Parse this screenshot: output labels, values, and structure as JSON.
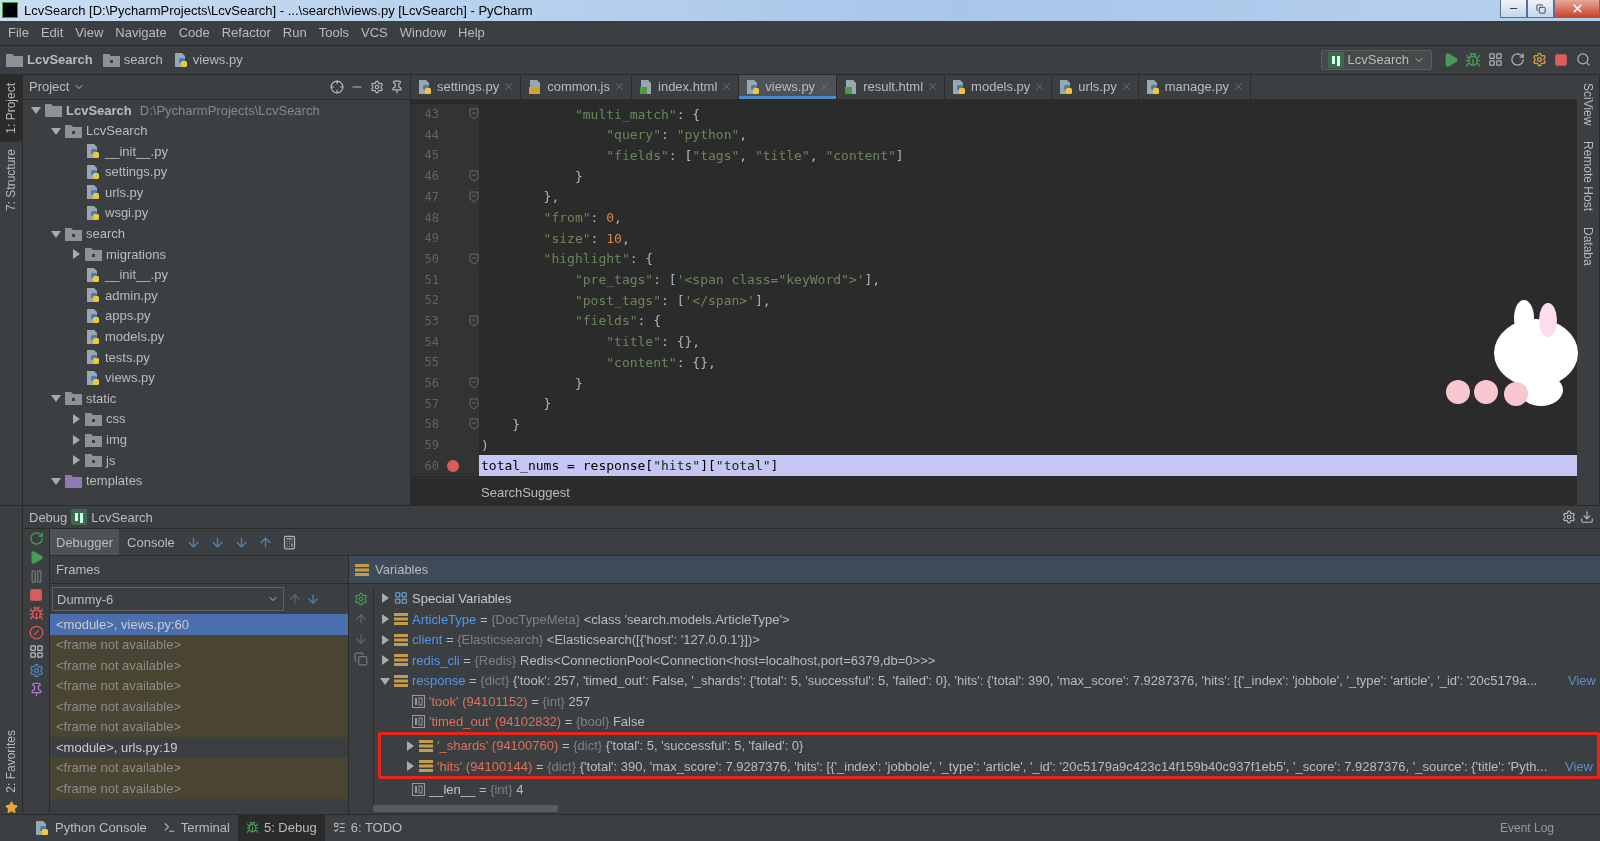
{
  "window": {
    "title": "LcvSearch [D:\\PycharmProjects\\LcvSearch] - ...\\search\\views.py [LcvSearch] - PyCharm"
  },
  "menu": [
    "File",
    "Edit",
    "View",
    "Navigate",
    "Code",
    "Refactor",
    "Run",
    "Tools",
    "VCS",
    "Window",
    "Help"
  ],
  "breadcrumbs": [
    {
      "kind": "project",
      "label": "LcvSearch"
    },
    {
      "kind": "folder",
      "label": "search"
    },
    {
      "kind": "py",
      "label": "views.py"
    }
  ],
  "run_config": {
    "label": "LcvSearch"
  },
  "left_strip": [
    {
      "label": "1: Project",
      "selected": true
    },
    {
      "label": "7: Structure",
      "selected": false
    }
  ],
  "left_strip_bottom": [
    {
      "label": "2: Favorites",
      "selected": false
    }
  ],
  "right_strip": [
    {
      "label": "SciView"
    },
    {
      "label": "Remote Host"
    },
    {
      "label": "Databa"
    }
  ],
  "project": {
    "title": "Project",
    "tree": [
      {
        "kind": "root",
        "label": "LcvSearch",
        "path": "D:\\PycharmProjects\\LcvSearch",
        "expanded": true,
        "children": [
          {
            "kind": "folder",
            "label": "LcvSearch",
            "expanded": true,
            "children": [
              {
                "kind": "py",
                "label": "__init__.py"
              },
              {
                "kind": "py",
                "label": "settings.py"
              },
              {
                "kind": "py",
                "label": "urls.py"
              },
              {
                "kind": "py",
                "label": "wsgi.py"
              }
            ]
          },
          {
            "kind": "folder",
            "label": "search",
            "expanded": true,
            "children": [
              {
                "kind": "folder",
                "label": "migrations",
                "expanded": false
              },
              {
                "kind": "py",
                "label": "__init__.py"
              },
              {
                "kind": "py",
                "label": "admin.py"
              },
              {
                "kind": "py",
                "label": "apps.py"
              },
              {
                "kind": "py",
                "label": "models.py"
              },
              {
                "kind": "py",
                "label": "tests.py"
              },
              {
                "kind": "py",
                "label": "views.py"
              }
            ]
          },
          {
            "kind": "folder",
            "label": "static",
            "expanded": true,
            "children": [
              {
                "kind": "folder",
                "label": "css",
                "expanded": false
              },
              {
                "kind": "folder",
                "label": "img",
                "expanded": false
              },
              {
                "kind": "folder",
                "label": "js",
                "expanded": false
              }
            ]
          },
          {
            "kind": "templates",
            "label": "templates",
            "expanded": true
          }
        ]
      }
    ]
  },
  "editor": {
    "tabs": [
      {
        "kind": "py",
        "label": "settings.py",
        "selected": false
      },
      {
        "kind": "js",
        "label": "common.js",
        "selected": false
      },
      {
        "kind": "html",
        "label": "index.html",
        "selected": false
      },
      {
        "kind": "py",
        "label": "views.py",
        "selected": true
      },
      {
        "kind": "html",
        "label": "result.html",
        "selected": false
      },
      {
        "kind": "py",
        "label": "models.py",
        "selected": false
      },
      {
        "kind": "py",
        "label": "urls.py",
        "selected": false
      },
      {
        "kind": "py",
        "label": "manage.py",
        "selected": false
      }
    ],
    "lines": [
      {
        "number": "43",
        "fold": true,
        "breakpoint": false,
        "current": false,
        "segments": [
          {
            "kind": "str",
            "text": "            \"multi_match\""
          },
          {
            "kind": "plain",
            "text": ": {"
          }
        ]
      },
      {
        "number": "44",
        "fold": false,
        "breakpoint": false,
        "current": false,
        "segments": [
          {
            "kind": "str",
            "text": "                \"query\""
          },
          {
            "kind": "plain",
            "text": ": "
          },
          {
            "kind": "str",
            "text": "\"python\""
          },
          {
            "kind": "plain",
            "text": ","
          }
        ]
      },
      {
        "number": "45",
        "fold": false,
        "breakpoint": false,
        "current": false,
        "segments": [
          {
            "kind": "str",
            "text": "                \"fields\""
          },
          {
            "kind": "plain",
            "text": ": ["
          },
          {
            "kind": "str",
            "text": "\"tags\""
          },
          {
            "kind": "plain",
            "text": ", "
          },
          {
            "kind": "str",
            "text": "\"title\""
          },
          {
            "kind": "plain",
            "text": ", "
          },
          {
            "kind": "str",
            "text": "\"content\""
          },
          {
            "kind": "plain",
            "text": "]"
          }
        ]
      },
      {
        "number": "46",
        "fold": true,
        "breakpoint": false,
        "current": false,
        "segments": [
          {
            "kind": "plain",
            "text": "            }"
          }
        ]
      },
      {
        "number": "47",
        "fold": true,
        "breakpoint": false,
        "current": false,
        "segments": [
          {
            "kind": "plain",
            "text": "        },"
          }
        ]
      },
      {
        "number": "48",
        "fold": false,
        "breakpoint": false,
        "current": false,
        "segments": [
          {
            "kind": "str",
            "text": "        \"from\""
          },
          {
            "kind": "plain",
            "text": ": "
          },
          {
            "kind": "num",
            "text": "0"
          },
          {
            "kind": "plain",
            "text": ","
          }
        ]
      },
      {
        "number": "49",
        "fold": false,
        "breakpoint": false,
        "current": false,
        "segments": [
          {
            "kind": "str",
            "text": "        \"size\""
          },
          {
            "kind": "plain",
            "text": ": "
          },
          {
            "kind": "num",
            "text": "10"
          },
          {
            "kind": "plain",
            "text": ","
          }
        ]
      },
      {
        "number": "50",
        "fold": true,
        "breakpoint": false,
        "current": false,
        "segments": [
          {
            "kind": "str",
            "text": "        \"highlight\""
          },
          {
            "kind": "plain",
            "text": ": {"
          }
        ]
      },
      {
        "number": "51",
        "fold": false,
        "breakpoint": false,
        "current": false,
        "segments": [
          {
            "kind": "str",
            "text": "            \"pre_tags\""
          },
          {
            "kind": "plain",
            "text": ": ["
          },
          {
            "kind": "str",
            "text": "'<span class=\"keyWord\">'"
          },
          {
            "kind": "plain",
            "text": "],"
          }
        ]
      },
      {
        "number": "52",
        "fold": false,
        "breakpoint": false,
        "current": false,
        "segments": [
          {
            "kind": "str",
            "text": "            \"post_tags\""
          },
          {
            "kind": "plain",
            "text": ": ["
          },
          {
            "kind": "str",
            "text": "'</span>'"
          },
          {
            "kind": "plain",
            "text": "],"
          }
        ]
      },
      {
        "number": "53",
        "fold": true,
        "breakpoint": false,
        "current": false,
        "segments": [
          {
            "kind": "str",
            "text": "            \"fields\""
          },
          {
            "kind": "plain",
            "text": ": {"
          }
        ]
      },
      {
        "number": "54",
        "fold": false,
        "breakpoint": false,
        "current": false,
        "segments": [
          {
            "kind": "str",
            "text": "                \"title\""
          },
          {
            "kind": "plain",
            "text": ": {},"
          }
        ]
      },
      {
        "number": "55",
        "fold": false,
        "breakpoint": false,
        "current": false,
        "segments": [
          {
            "kind": "str",
            "text": "                \"content\""
          },
          {
            "kind": "plain",
            "text": ": {},"
          }
        ]
      },
      {
        "number": "56",
        "fold": true,
        "breakpoint": false,
        "current": false,
        "segments": [
          {
            "kind": "plain",
            "text": "            }"
          }
        ]
      },
      {
        "number": "57",
        "fold": true,
        "breakpoint": false,
        "current": false,
        "segments": [
          {
            "kind": "plain",
            "text": "        }"
          }
        ]
      },
      {
        "number": "58",
        "fold": true,
        "breakpoint": false,
        "current": false,
        "segments": [
          {
            "kind": "plain",
            "text": "    }"
          }
        ]
      },
      {
        "number": "59",
        "fold": false,
        "breakpoint": false,
        "current": false,
        "segments": [
          {
            "kind": "plain",
            "text": ")"
          }
        ]
      },
      {
        "number": "60",
        "fold": false,
        "breakpoint": true,
        "current": true,
        "segments": [
          {
            "kind": "plain",
            "text": "total_nums = response["
          },
          {
            "kind": "str",
            "text": "\"hits\""
          },
          {
            "kind": "plain",
            "text": "]["
          },
          {
            "kind": "str",
            "text": "\"total\""
          },
          {
            "kind": "plain",
            "text": "]"
          }
        ]
      }
    ],
    "breadcrumb": "SearchSuggest"
  },
  "debug": {
    "title": "Debug",
    "config": "LcvSearch",
    "tabs": [
      {
        "label": "Debugger",
        "selected": true
      },
      {
        "label": "Console",
        "selected": false
      }
    ],
    "frames": {
      "title": "Frames",
      "thread": "Dummy-6",
      "items": [
        {
          "kind": "module",
          "label": "<module>, views.py:60",
          "selected": true
        },
        {
          "kind": "unavailable",
          "label": "<frame not available>",
          "selected": false
        },
        {
          "kind": "unavailable",
          "label": "<frame not available>",
          "selected": false
        },
        {
          "kind": "unavailable",
          "label": "<frame not available>",
          "selected": false
        },
        {
          "kind": "unavailable",
          "label": "<frame not available>",
          "selected": false
        },
        {
          "kind": "unavailable",
          "label": "<frame not available>",
          "selected": false
        },
        {
          "kind": "module",
          "label": "<module>, urls.py:19",
          "selected": false
        },
        {
          "kind": "unavailable",
          "label": "<frame not available>",
          "selected": false
        },
        {
          "kind": "unavailable",
          "label": "<frame not available>",
          "selected": false
        }
      ]
    },
    "variables": {
      "title": "Variables",
      "items": [
        {
          "kind": "special",
          "color": "#c8c8c8",
          "name": "Special Variables",
          "expanded": false
        },
        {
          "kind": "object",
          "color": "#5394ec",
          "name": "ArticleType",
          "sep": "=",
          "type": "{DocTypeMeta}",
          "value": "<class 'search.models.ArticleType'>",
          "expanded": false
        },
        {
          "kind": "object",
          "color": "#5394ec",
          "name": "client",
          "sep": "=",
          "type": "{Elasticsearch}",
          "value": "<Elasticsearch([{'host': '127.0.0.1'}])>",
          "expanded": false
        },
        {
          "kind": "object",
          "color": "#5394ec",
          "name": "redis_cli",
          "sep": "=",
          "type": "{Redis}",
          "value": "Redis<ConnectionPool<Connection<host=localhost,port=6379,db=0>>>",
          "expanded": false
        },
        {
          "kind": "object",
          "color": "#5394ec",
          "name": "response",
          "sep": "=",
          "type": "{dict}",
          "value": "{'took': 257, 'timed_out': False, '_shards': {'total': 5, 'successful': 5, 'failed': 0}, 'hits': {'total': 390, 'max_score': 7.9287376, 'hits': [{'_index': 'jobbole', '_type': 'article', '_id': '20c5179a...",
          "link": "View",
          "expanded": true,
          "children": [
            {
              "kind": "number",
              "color": "#e0705a",
              "name": "'took' (94101152)",
              "sep": "=",
              "type": "{int}",
              "value": "257",
              "marked": false
            },
            {
              "kind": "number",
              "color": "#e0705a",
              "name": "'timed_out' (94102832)",
              "sep": "=",
              "type": "{bool}",
              "value": "False",
              "marked": false
            },
            {
              "kind": "object",
              "color": "#e0705a",
              "name": "'_shards' (94100760)",
              "sep": "=",
              "type": "{dict}",
              "value": "{'total': 5, 'successful': 5, 'failed': 0}",
              "expanded": false,
              "marked": true
            },
            {
              "kind": "object",
              "color": "#e0705a",
              "name": "'hits' (94100144)",
              "sep": "=",
              "type": "{dict}",
              "value": "{'total': 390, 'max_score': 7.9287376, 'hits': [{'_index': 'jobbole', '_type': 'article', '_id': '20c5179a9c423c14f159b40c937f1eb5', '_score': 7.9287376, '_source': {'title': 'Pyth...",
              "link": "View",
              "expanded": false,
              "marked": true
            },
            {
              "kind": "number",
              "color": "#c8c8c8",
              "name": "__len__",
              "sep": "=",
              "type": "{int}",
              "value": "4",
              "marked": false
            }
          ]
        }
      ]
    }
  },
  "bottom_bar": {
    "tabs": [
      {
        "kind": "python",
        "label": "Python Console",
        "selected": false
      },
      {
        "kind": "terminal",
        "label": "Terminal",
        "selected": false
      },
      {
        "kind": "debug",
        "label": "5: Debug",
        "selected": true
      },
      {
        "kind": "todo",
        "label": "6: TODO",
        "selected": false
      }
    ],
    "event_log": "Event Log"
  }
}
